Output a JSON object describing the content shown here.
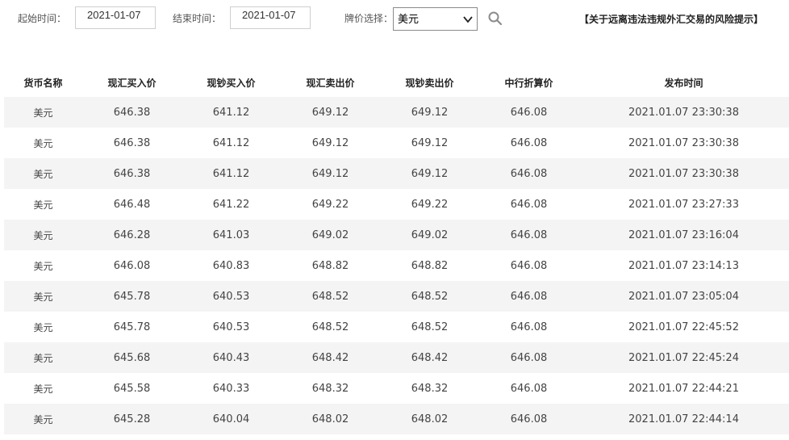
{
  "filters": {
    "start_label": "起始时间：",
    "start_value": "2021-01-07",
    "end_label": "结束时间：",
    "end_value": "2021-01-07",
    "currency_label": "牌价选择：",
    "currency_value": "美元",
    "search_icon": "search-icon",
    "risk_link": "【关于远离违法违规外汇交易的风险提示】"
  },
  "table": {
    "headers": [
      "货币名称",
      "现汇买入价",
      "现钞买入价",
      "现汇卖出价",
      "现钞卖出价",
      "中行折算价",
      "发布时间"
    ],
    "rows": [
      [
        "美元",
        "646.38",
        "641.12",
        "649.12",
        "649.12",
        "646.08",
        "2021.01.07 23:30:38"
      ],
      [
        "美元",
        "646.38",
        "641.12",
        "649.12",
        "649.12",
        "646.08",
        "2021.01.07 23:30:38"
      ],
      [
        "美元",
        "646.38",
        "641.12",
        "649.12",
        "649.12",
        "646.08",
        "2021.01.07 23:30:38"
      ],
      [
        "美元",
        "646.48",
        "641.22",
        "649.22",
        "649.22",
        "646.08",
        "2021.01.07 23:27:33"
      ],
      [
        "美元",
        "646.28",
        "641.03",
        "649.02",
        "649.02",
        "646.08",
        "2021.01.07 23:16:04"
      ],
      [
        "美元",
        "646.08",
        "640.83",
        "648.82",
        "648.82",
        "646.08",
        "2021.01.07 23:14:13"
      ],
      [
        "美元",
        "645.78",
        "640.53",
        "648.52",
        "648.52",
        "646.08",
        "2021.01.07 23:05:04"
      ],
      [
        "美元",
        "645.78",
        "640.53",
        "648.52",
        "648.52",
        "646.08",
        "2021.01.07 22:45:52"
      ],
      [
        "美元",
        "645.68",
        "640.43",
        "648.42",
        "648.42",
        "646.08",
        "2021.01.07 22:45:24"
      ],
      [
        "美元",
        "645.58",
        "640.33",
        "648.32",
        "648.32",
        "646.08",
        "2021.01.07 22:44:21"
      ],
      [
        "美元",
        "645.28",
        "640.04",
        "648.02",
        "648.02",
        "646.08",
        "2021.01.07 22:44:14"
      ]
    ]
  }
}
